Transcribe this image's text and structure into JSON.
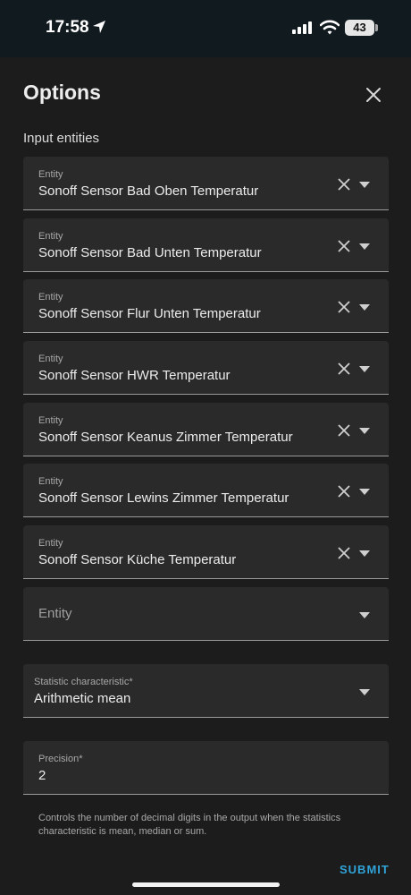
{
  "status": {
    "time": "17:58",
    "battery": "43"
  },
  "dialog": {
    "title": "Options",
    "section_label": "Input entities",
    "entity_fields": [
      {
        "label": "Entity",
        "value": "Sonoff Sensor Bad Oben Temperatur"
      },
      {
        "label": "Entity",
        "value": "Sonoff Sensor Bad Unten Temperatur"
      },
      {
        "label": "Entity",
        "value": "Sonoff Sensor Flur Unten Temperatur"
      },
      {
        "label": "Entity",
        "value": "Sonoff Sensor HWR Temperatur"
      },
      {
        "label": "Entity",
        "value": "Sonoff Sensor Keanus Zimmer Temperatur"
      },
      {
        "label": "Entity",
        "value": "Sonoff Sensor Lewins Zimmer Temperatur"
      },
      {
        "label": "Entity",
        "value": "Sonoff Sensor Küche Temperatur"
      }
    ],
    "empty_entity_placeholder": "Entity",
    "statistic": {
      "label": "Statistic characteristic*",
      "value": "Arithmetic mean"
    },
    "precision": {
      "label": "Precision*",
      "value": "2"
    },
    "helper_text": "Controls the number of decimal digits in the output when the statistics characteristic is mean, median or sum.",
    "submit_label": "SUBMIT"
  },
  "icons": {
    "location": "location-arrow-icon",
    "signal": "cellular-signal-icon",
    "wifi": "wifi-icon",
    "close": "close-icon",
    "clear": "clear-icon",
    "dropdown": "dropdown-arrow-icon"
  },
  "colors": {
    "background": "#1c1c1c",
    "field_background": "#2a2a2a",
    "accent": "#30a3d8",
    "status_bar": "#111a1f"
  }
}
